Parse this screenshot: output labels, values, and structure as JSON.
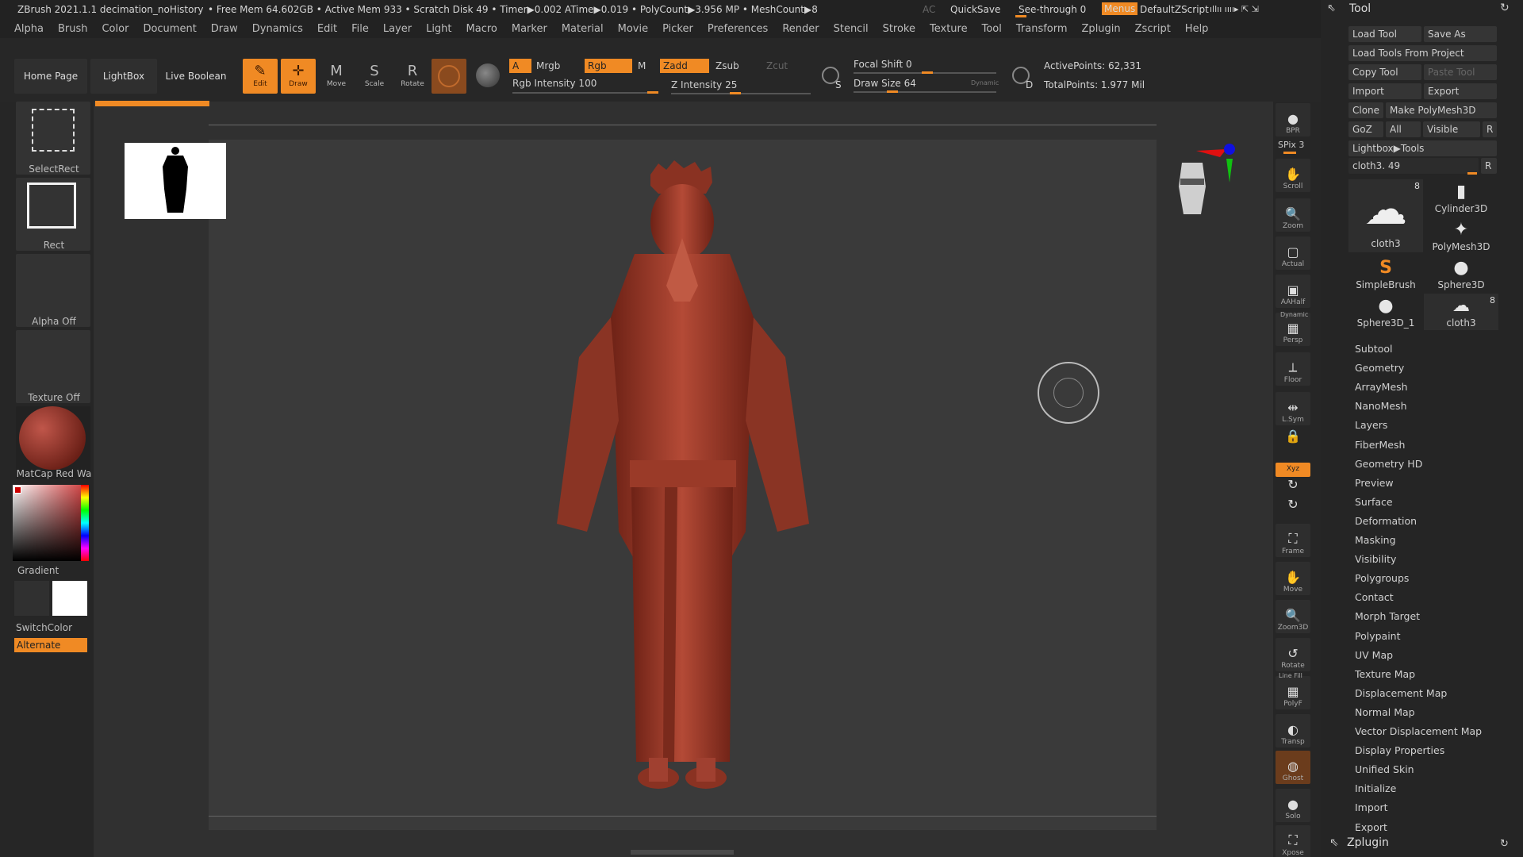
{
  "titlebar": {
    "app": "ZBrush 2021.1.1 decimation_noHistory",
    "stats": "• Free Mem 64.602GB • Active Mem 933 • Scratch Disk 49 • Timer▶0.002 ATime▶0.019 • PolyCount▶3.956 MP • MeshCount▶8",
    "ac": "AC",
    "quicksave": "QuickSave",
    "seethrough": "See-through  0",
    "menus": "Menus",
    "script": "DefaultZScript"
  },
  "menubar": [
    "Alpha",
    "Brush",
    "Color",
    "Document",
    "Draw",
    "Dynamics",
    "Edit",
    "File",
    "Layer",
    "Light",
    "Macro",
    "Marker",
    "Material",
    "Movie",
    "Picker",
    "Preferences",
    "Render",
    "Stencil",
    "Stroke",
    "Texture",
    "Tool",
    "Transform",
    "Zplugin",
    "Zscript",
    "Help"
  ],
  "topbar": {
    "home": "Home Page",
    "lightbox": "LightBox",
    "live_boolean": "Live Boolean",
    "tools": [
      {
        "label": "Edit",
        "glyph": "✎",
        "active": true
      },
      {
        "label": "Draw",
        "glyph": "✛",
        "active": true
      },
      {
        "label": "Move",
        "glyph": "M",
        "active": false
      },
      {
        "label": "Scale",
        "glyph": "S",
        "active": false
      },
      {
        "label": "Rotate",
        "glyph": "R",
        "active": false
      }
    ],
    "a": "A",
    "mrgb": "Mrgb",
    "rgb": "Rgb",
    "m": "M",
    "zadd": "Zadd",
    "zsub": "Zsub",
    "zcut": "Zcut",
    "rgb_intensity": "Rgb Intensity 100",
    "z_intensity": "Z Intensity 25",
    "focal_shift": "Focal Shift 0",
    "draw_size": "Draw Size 64",
    "dynamic": "Dynamic",
    "s": "S",
    "d": "D",
    "active_points": "ActivePoints: 62,331",
    "total_points": "TotalPoints: 1.977 Mil"
  },
  "leftshelf": {
    "select_rect": "SelectRect",
    "rect": "Rect",
    "alpha_off": "Alpha Off",
    "texture_off": "Texture Off",
    "matcap": "MatCap Red Wa",
    "gradient": "Gradient",
    "switch_color": "SwitchColor",
    "alternate": "Alternate"
  },
  "rdock": {
    "spix": "SPix 3",
    "items": [
      "BPR",
      "Scroll",
      "Zoom",
      "Actual",
      "AAHalf",
      "Persp",
      "Floor",
      "L.Sym",
      "",
      "Xyz",
      "",
      "",
      "Frame",
      "Move",
      "Zoom3D",
      "Rotate",
      "PolyF",
      "Transp",
      "Ghost",
      "Solo",
      "Xpose"
    ],
    "dynamic": "Dynamic",
    "line_fill": "Line Fill"
  },
  "toolpal": {
    "title": "Tool",
    "load_tool": "Load Tool",
    "save_as": "Save As",
    "load_from_project": "Load Tools From Project",
    "copy_tool": "Copy Tool",
    "paste_tool": "Paste Tool",
    "import": "Import",
    "export": "Export",
    "clone": "Clone",
    "make_polymesh": "Make PolyMesh3D",
    "goz": "GoZ",
    "all": "All",
    "visible": "Visible",
    "r": "R",
    "lightbox_tools": "Lightbox▶Tools",
    "current_tool": "cloth3. 49",
    "tools_grid": [
      {
        "name": "cloth3",
        "badge": "8"
      },
      {
        "name": "Cylinder3D",
        "badge": ""
      },
      {
        "name": "PolyMesh3D",
        "badge": ""
      },
      {
        "name": "SimpleBrush",
        "badge": ""
      },
      {
        "name": "Sphere3D",
        "badge": ""
      },
      {
        "name": "Sphere3D_1",
        "badge": ""
      },
      {
        "name": "cloth3",
        "badge": "8"
      }
    ],
    "sections": [
      "Subtool",
      "Geometry",
      "ArrayMesh",
      "NanoMesh",
      "Layers",
      "FiberMesh",
      "Geometry HD",
      "Preview",
      "Surface",
      "Deformation",
      "Masking",
      "Visibility",
      "Polygroups",
      "Contact",
      "Morph Target",
      "Polypaint",
      "UV Map",
      "Texture Map",
      "Displacement Map",
      "Normal Map",
      "Vector Displacement Map",
      "Display Properties",
      "Unified Skin",
      "Initialize",
      "Import",
      "Export"
    ],
    "zplugin": "Zplugin"
  },
  "colors": {
    "accent": "#f08a24",
    "model": "#a5402f"
  }
}
